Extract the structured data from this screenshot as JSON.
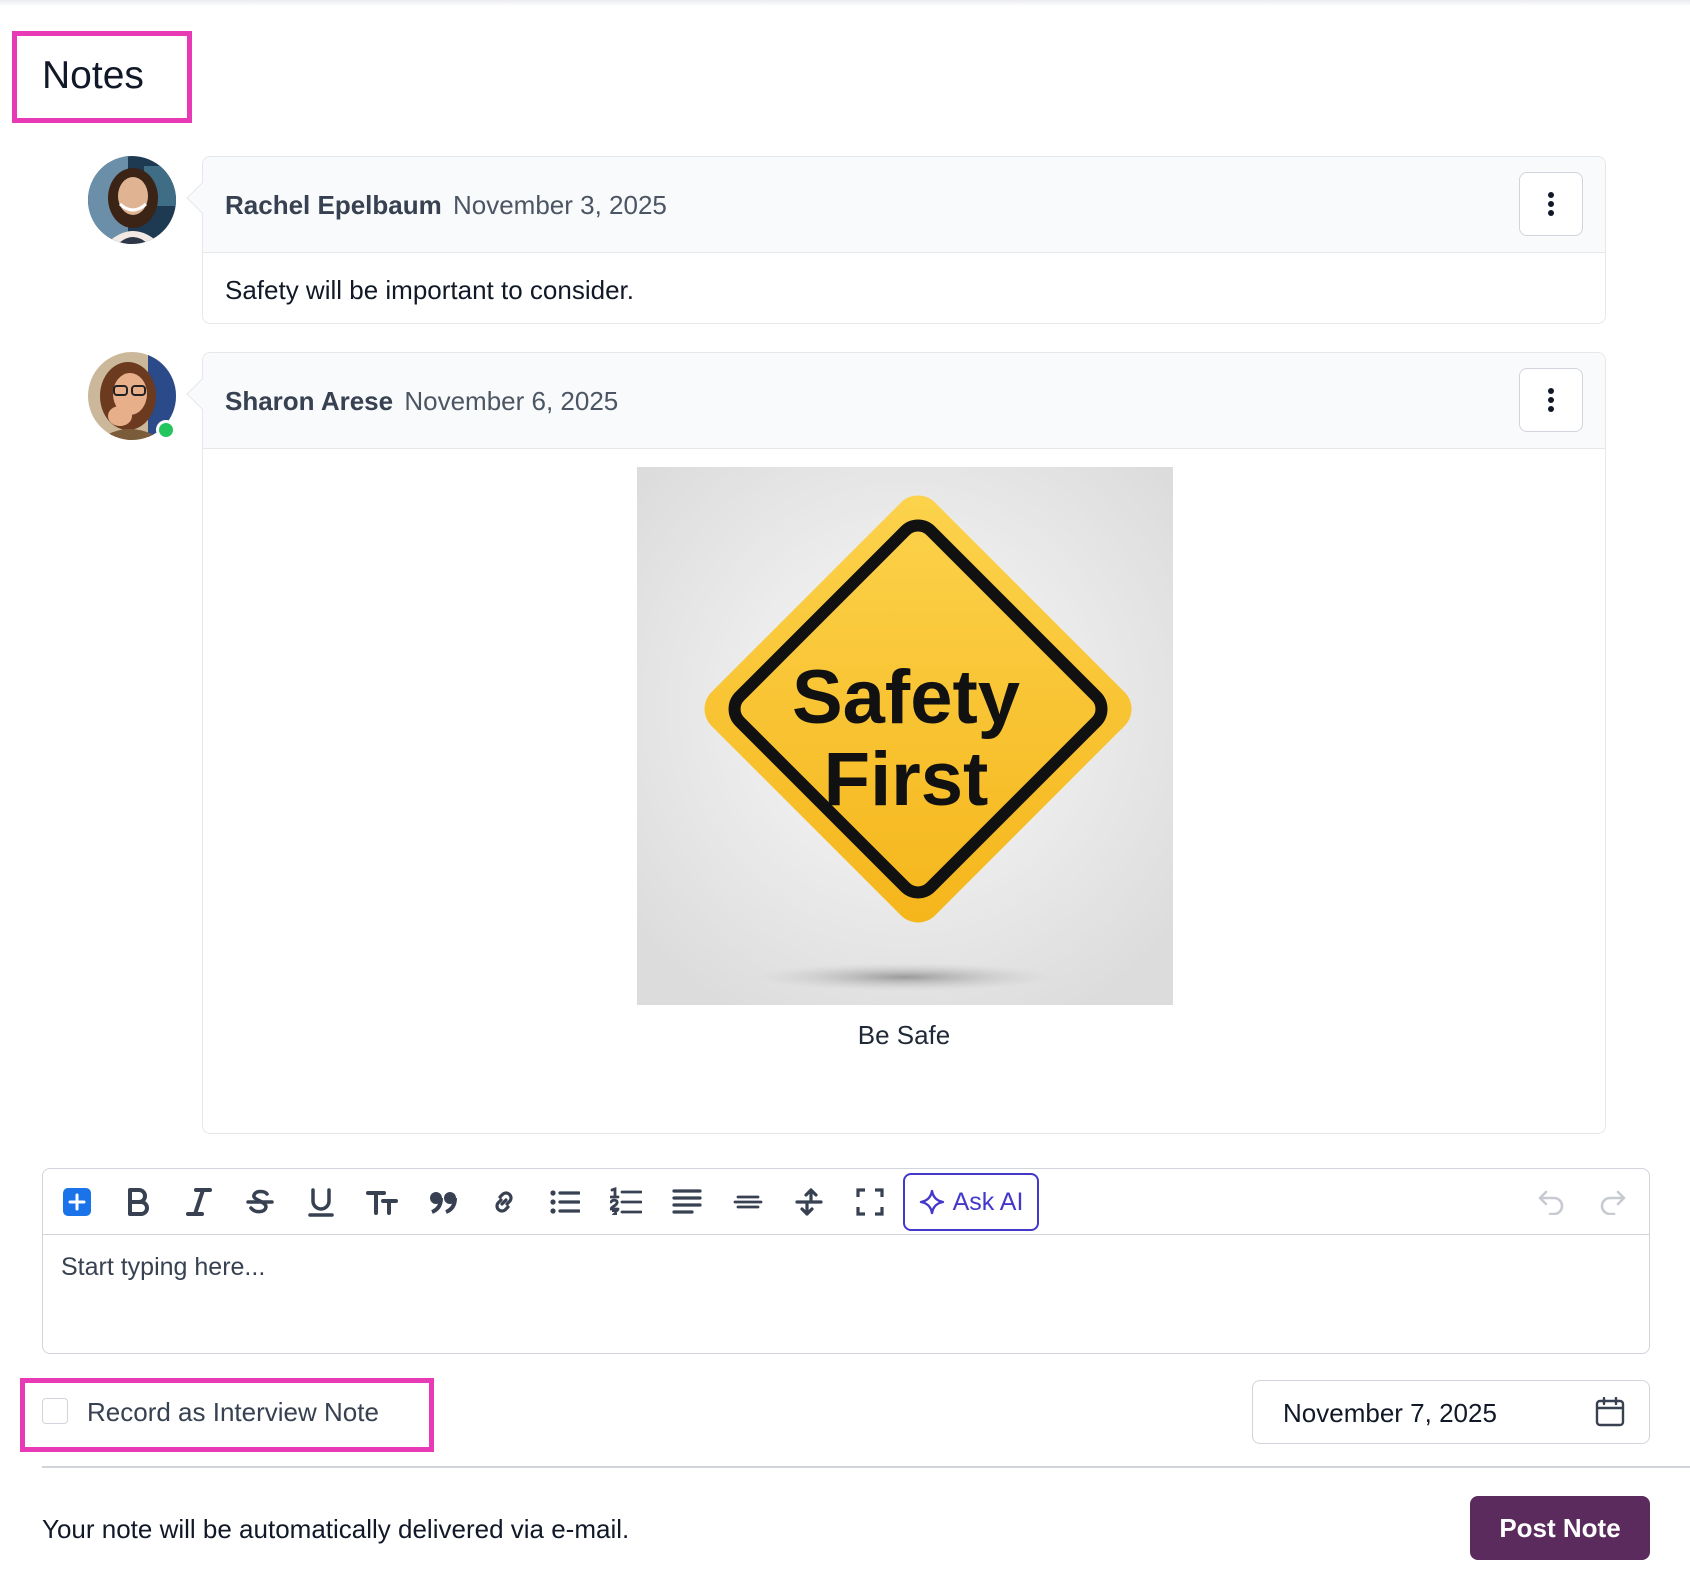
{
  "page": {
    "title": "Notes"
  },
  "notes": [
    {
      "author": "Rachel Epelbaum",
      "date": "November 3, 2025",
      "body": "Safety will be important to consider.",
      "online": false
    },
    {
      "author": "Sharon Arese",
      "date": "November 6, 2025",
      "image": {
        "line1": "Safety",
        "line2": "First"
      },
      "caption": "Be Safe",
      "online": true
    }
  ],
  "editor": {
    "placeholder": "Start typing here...",
    "ask_ai_label": "Ask AI",
    "toolbar_icons": [
      "plus-icon",
      "bold-icon",
      "italic-icon",
      "strikethrough-icon",
      "underline-icon",
      "text-size-icon",
      "quote-icon",
      "link-icon",
      "bullet-list-icon",
      "numbered-list-icon",
      "align-justify-icon",
      "horizontal-rule-icon",
      "clear-format-icon",
      "fullscreen-icon",
      "sparkle-icon",
      "undo-icon",
      "redo-icon"
    ]
  },
  "interview_note": {
    "label": "Record as Interview Note",
    "checked": false
  },
  "date_picker": {
    "value": "November 7, 2025",
    "icon": "calendar-icon"
  },
  "footer": {
    "message": "Your note will be automatically delivered via e-mail.",
    "post_label": "Post Note"
  },
  "colors": {
    "highlight": "#e83ab5",
    "accent": "#4338ca",
    "primary_button": "#5b2b5e",
    "plus_button": "#1a73e8",
    "online": "#22c55e",
    "sign_yellow": "#fbbf24"
  }
}
